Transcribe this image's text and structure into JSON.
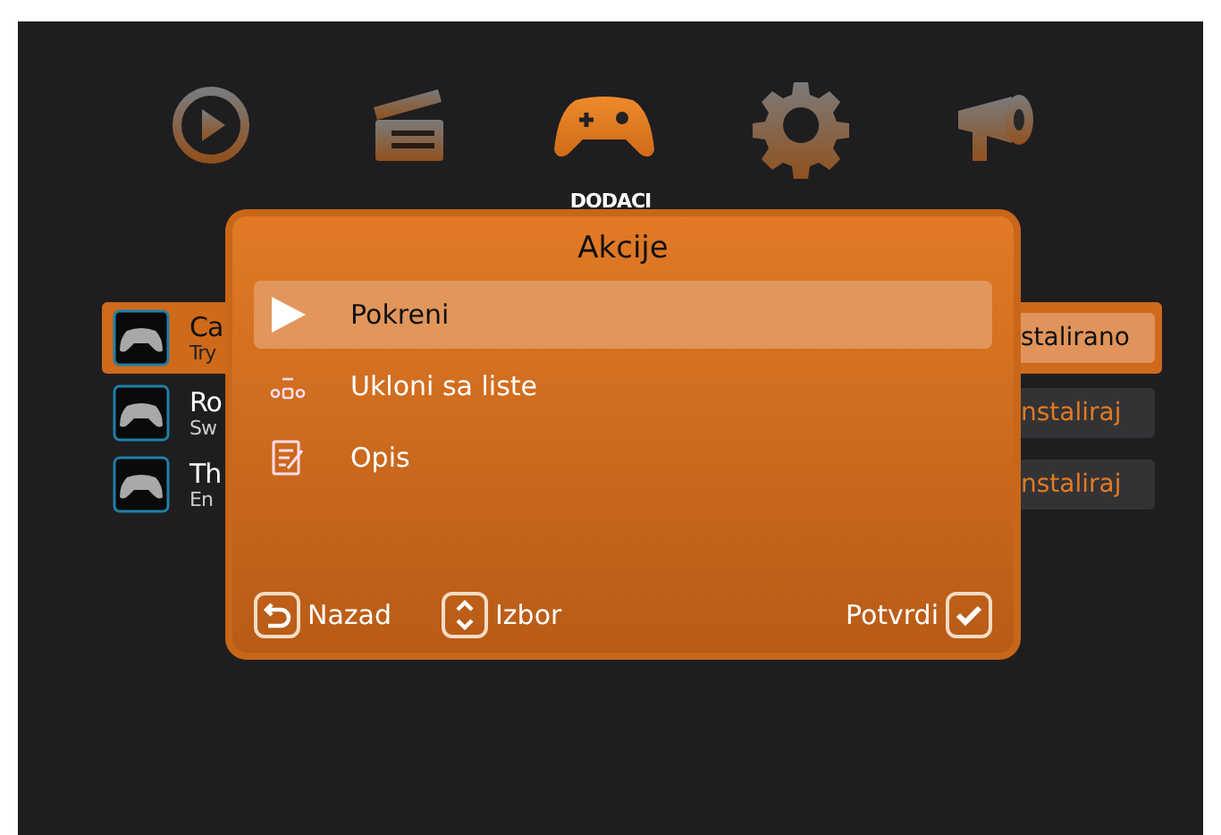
{
  "top_menu": {
    "items": [
      {
        "kind": "play",
        "selected": false
      },
      {
        "kind": "clapper",
        "selected": false
      },
      {
        "kind": "gamepad",
        "selected": true
      },
      {
        "kind": "gear",
        "selected": false
      },
      {
        "kind": "megaphone",
        "selected": false
      }
    ],
    "label": "DODACI"
  },
  "addons": [
    {
      "title": "Ca",
      "subtitle": "Try",
      "status": "stalirano",
      "selected": true
    },
    {
      "title": "Ro",
      "subtitle": "Sw",
      "status": "nstaliraj",
      "selected": false
    },
    {
      "title": "Th",
      "subtitle": "En",
      "status": "nstaliraj",
      "selected": false
    }
  ],
  "dialog": {
    "title": "Akcije",
    "items": [
      {
        "kind": "play",
        "label": "Pokreni",
        "selected": true
      },
      {
        "kind": "remove",
        "label": "Ukloni sa liste",
        "selected": false
      },
      {
        "kind": "edit",
        "label": "Opis",
        "selected": false
      }
    ],
    "footer": [
      {
        "kind": "back",
        "label": "Nazad"
      },
      {
        "kind": "updown",
        "label": "Izbor"
      },
      {
        "kind": "check",
        "label": "Potvrdi"
      }
    ]
  }
}
